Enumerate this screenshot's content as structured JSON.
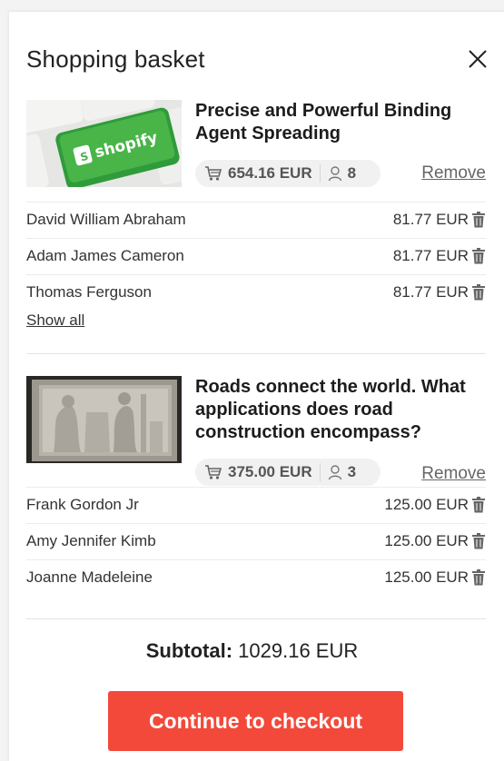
{
  "header": {
    "title": "Shopping basket"
  },
  "products": [
    {
      "title": "Precise and Powerful Binding Agent Spreading",
      "amount": "654.16 EUR",
      "count": "8",
      "remove_label": "Remove",
      "image_label": "shopify",
      "recipients": [
        {
          "name": "David William Abraham",
          "price": "81.77 EUR"
        },
        {
          "name": "Adam James Cameron",
          "price": "81.77 EUR"
        },
        {
          "name": "Thomas Ferguson",
          "price": "81.77 EUR"
        }
      ],
      "show_all_label": "Show all"
    },
    {
      "title": "Roads connect the world. What applications does road construction encompass?",
      "amount": "375.00 EUR",
      "count": "3",
      "remove_label": "Remove",
      "recipients": [
        {
          "name": "Frank Gordon Jr",
          "price": "125.00 EUR"
        },
        {
          "name": "Amy Jennifer Kimb",
          "price": "125.00 EUR"
        },
        {
          "name": "Joanne Madeleine",
          "price": "125.00 EUR"
        }
      ]
    }
  ],
  "summary": {
    "subtotal_label": "Subtotal:",
    "subtotal_value": "1029.16 EUR"
  },
  "checkout": {
    "label": "Continue to checkout"
  },
  "colors": {
    "accent": "#f3493a",
    "pill_bg": "#f1f1f1"
  },
  "icons": [
    "close-icon",
    "cart-icon",
    "user-icon",
    "trash-icon"
  ]
}
